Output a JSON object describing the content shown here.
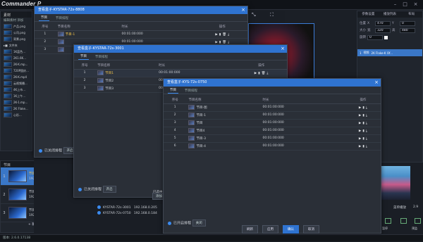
{
  "app": {
    "logo": "Commander P",
    "status_left": "版本: 2.6.0.17138"
  },
  "left_panel": {
    "header": "素材",
    "toolbar": "编辑素材 添加",
    "assets": [
      {
        "name": "产品.png"
      },
      {
        "name": "公司.png"
      },
      {
        "name": "背景.png"
      }
    ],
    "folder_label": "文件夹",
    "folder_items": [
      {
        "name": "1K蓝色..."
      },
      {
        "name": "2K1.6K..."
      },
      {
        "name": "2K-K.mp..."
      },
      {
        "name": "720P国庆..."
      },
      {
        "name": "2K-K.mp4"
      },
      {
        "name": "云视频播..."
      },
      {
        "name": "4K上市..."
      },
      {
        "name": "1K上午..."
      },
      {
        "name": "2K-1.mp..."
      },
      {
        "name": "2K Flake..."
      },
      {
        "name": "心形..."
      }
    ]
  },
  "programs": {
    "header": "节目",
    "items": [
      {
        "num": "1",
        "name": "节目1",
        "res": "1920×1080"
      },
      {
        "num": "2",
        "name": "节目2",
        "res": "1920×1080"
      },
      {
        "num": "3",
        "name": "节目3",
        "res": "1920×1080"
      }
    ],
    "add_label": "+ 新建节目"
  },
  "right_panel": {
    "tabs": [
      "参数设置",
      "播放列表",
      "布局"
    ],
    "pos_label": "位置",
    "size_label": "大小",
    "x": "470",
    "y": "0",
    "w": "320",
    "h": "480",
    "x_lbl": "X",
    "y_lbl": "Y",
    "w_lbl": "宽",
    "h_lbl": "高",
    "rot_lbl": "旋转",
    "rot": "0",
    "layer_num": "1",
    "layer_type": "视频",
    "layer_name": "2K Flake-K Of...",
    "bottom_labels": [
      "25",
      "菜单播放",
      "2.9",
      "暂停",
      "预监"
    ]
  },
  "dialog1": {
    "title": "查看盒子-KYSTAR-72s-8808",
    "tabs": [
      "节目",
      "节目排程"
    ],
    "headers": [
      "序号",
      "节目名称",
      "时长",
      "操作"
    ],
    "rows": [
      {
        "num": "1",
        "name": "节目-1",
        "dur": "00:01:00:000"
      },
      {
        "num": "2",
        "name": "",
        "dur": "00:01:00:000"
      },
      {
        "num": "3",
        "name": "",
        "dur": "00:01:00:000"
      }
    ],
    "footer_label": "已关闭排程",
    "footer_btn": "开启"
  },
  "dialog2": {
    "title": "查看盒子-KYSTAR-72s-3001",
    "tabs": [
      "节目",
      "节目排程"
    ],
    "headers": [
      "序号",
      "节目名称",
      "时长",
      "操作"
    ],
    "rows": [
      {
        "num": "1",
        "name": "节目1",
        "dur": "00:01:00:000"
      },
      {
        "num": "2",
        "name": "节目2",
        "dur": "00:01:00:000"
      },
      {
        "num": "3",
        "name": "节目3",
        "dur": "00:01:00:000"
      }
    ],
    "footer_label": "已关闭排程",
    "footer_btn": "开启",
    "side_btn": "添加",
    "devices": [
      {
        "name": "KYSTAR-72s-3001",
        "ip": "192.168.0.205"
      },
      {
        "name": "KYSTAR-72s-0750",
        "ip": "192.168.0.184"
      }
    ],
    "selected_text": "已选中1个设备"
  },
  "dialog3": {
    "title": "查看盒子-KYS-72s-0750",
    "tabs": [
      "节目",
      "节目排程"
    ],
    "headers": [
      "序号",
      "节目名称",
      "时长",
      "操作"
    ],
    "rows": [
      {
        "num": "1",
        "name": "节目-图",
        "dur": "00:01:00:000"
      },
      {
        "num": "2",
        "name": "节目-1",
        "dur": "00:01:00:000"
      },
      {
        "num": "3",
        "name": "节目",
        "dur": "00:01:00:000"
      },
      {
        "num": "4",
        "name": "节目4",
        "dur": "00:01:00:000"
      },
      {
        "num": "5",
        "name": "节目-3",
        "dur": "00:01:00:000"
      },
      {
        "num": "6",
        "name": "节目-4",
        "dur": "00:01:00:000"
      }
    ],
    "footer_label": "已开启排程",
    "footer_btn": "关闭",
    "buttons": [
      "刷新",
      "应用",
      "确认",
      "取消"
    ]
  },
  "colors": {
    "accent": "#2f73d0",
    "bg": "#1b1f26",
    "selected": "#3a77c7"
  }
}
